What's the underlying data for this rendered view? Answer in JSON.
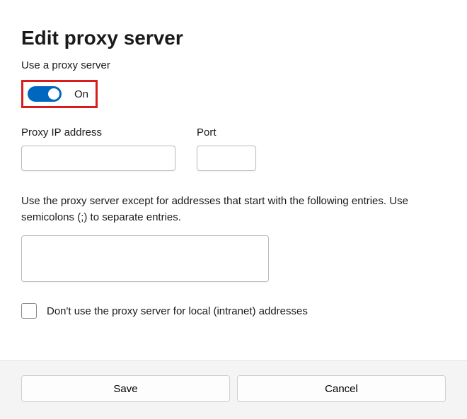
{
  "title": "Edit proxy server",
  "useProxyLabel": "Use a proxy server",
  "toggle": {
    "state": "On",
    "on": true
  },
  "ipField": {
    "label": "Proxy IP address",
    "value": ""
  },
  "portField": {
    "label": "Port",
    "value": ""
  },
  "exceptionsHelp": "Use the proxy server except for addresses that start with the following entries. Use semicolons (;) to separate entries.",
  "exceptionsValue": "",
  "localBypass": {
    "checked": false,
    "label": "Don't use the proxy server for local (intranet) addresses"
  },
  "buttons": {
    "save": "Save",
    "cancel": "Cancel"
  },
  "colors": {
    "accent": "#0067c0",
    "highlightBorder": "#d91c1c"
  }
}
